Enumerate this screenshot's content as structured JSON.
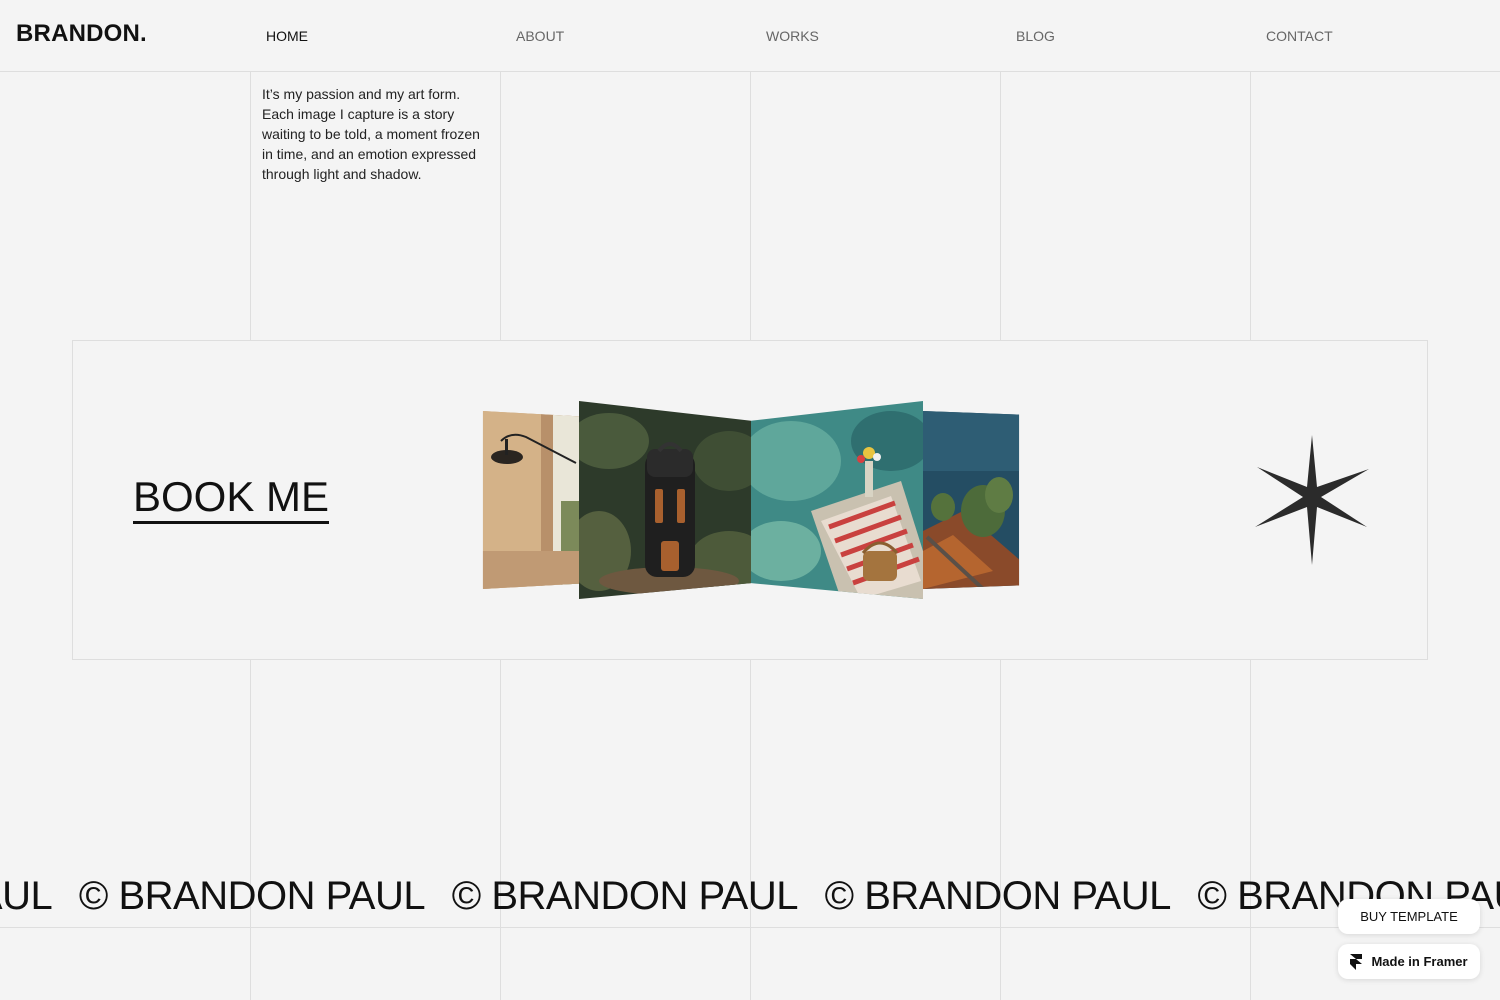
{
  "header": {
    "logo": "BRANDON.",
    "nav": [
      "HOME",
      "ABOUT",
      "WORKS",
      "BLOG",
      "CONTACT"
    ],
    "active_nav": "HOME"
  },
  "intro": {
    "text": "It’s my passion and my art form. Each image I capture is a story waiting to be told, a moment frozen in time, and an emotion expressed through light and shadow."
  },
  "booking": {
    "label": "BOOK ME",
    "gallery": [
      {
        "subject": "interior-wall-lamp"
      },
      {
        "subject": "backpack"
      },
      {
        "subject": "seaside-picnic"
      },
      {
        "subject": "lake-landscape"
      }
    ],
    "star_icon": "eight-point-star-icon"
  },
  "marquee": {
    "items": [
      "© BRANDON PAUL",
      "© BRANDON PAUL",
      "© BRANDON PAUL",
      "© BRANDON PAUL",
      "© BRANDON PAUL"
    ]
  },
  "floating": {
    "buy_label": "BUY TEMPLATE",
    "framer_label": "Made in Framer"
  },
  "colors": {
    "background": "#f4f4f4",
    "text": "#111111",
    "grid": "#dedede"
  }
}
